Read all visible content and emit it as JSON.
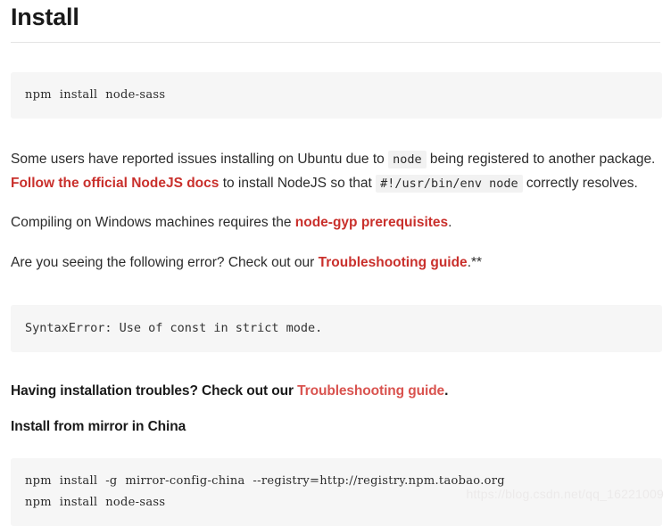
{
  "page": {
    "title": "Install"
  },
  "code_blocks": {
    "install_basic": "npm  install  node-sass",
    "syntax_error": "SyntaxError: Use of const in strict mode.",
    "china_mirror_line1": "npm  install  -g  mirror-config-china  --registry=http://registry.npm.taobao.org",
    "china_mirror_line2": "npm  install  node-sass"
  },
  "paragraphs": {
    "ubuntu": {
      "part1": "Some users have reported issues installing on Ubuntu due to ",
      "code1": "node",
      "part2": " being registered to another package. ",
      "link1": "Follow the official NodeJS docs",
      "part3": " to install NodeJS so that ",
      "code2": "#!/usr/bin/env node",
      "part4": " correctly resolves."
    },
    "windows": {
      "part1": "Compiling on Windows machines requires the ",
      "link1": "node-gyp prerequisites",
      "part2": "."
    },
    "error_check": {
      "part1": "Are you seeing the following error? Check out our ",
      "link1": "Troubleshooting guide",
      "part2": ".**"
    }
  },
  "headings": {
    "troubles": {
      "part1": "Having installation troubles? Check out our ",
      "link1": "Troubleshooting guide",
      "part2": "."
    },
    "china": "Install from mirror in China"
  },
  "watermark": {
    "text": "https://blog.csdn.net/qq_16221009"
  },
  "colors": {
    "link_red": "#c9302c",
    "link_red_soft": "#d9534f",
    "code_bg": "#f6f6f6",
    "inline_code_bg": "#f2f2f2",
    "rule": "#e4e4e4",
    "text": "#2c2c2c",
    "watermark": "#eceaea"
  }
}
